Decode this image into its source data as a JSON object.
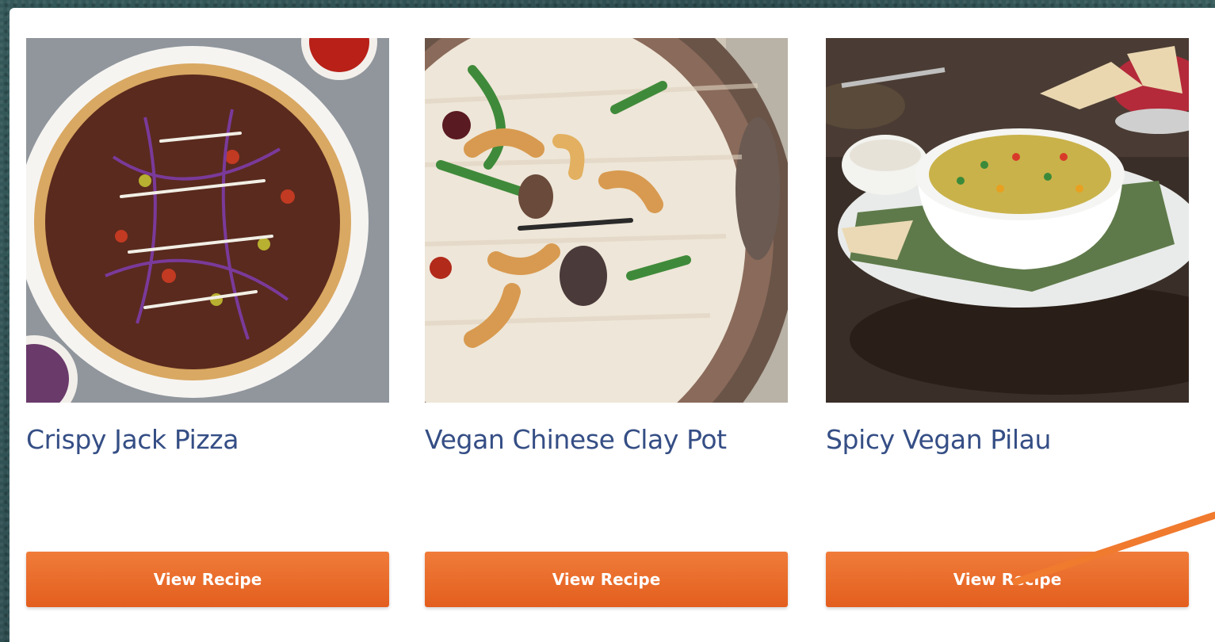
{
  "cards": [
    {
      "title": "Crispy Jack Pizza",
      "button_label": "View Recipe",
      "image_icon": "pizza-photo-icon"
    },
    {
      "title": "Vegan Chinese Clay Pot",
      "button_label": "View Recipe",
      "image_icon": "clay-pot-rice-photo-icon"
    },
    {
      "title": "Spicy Vegan Pilau",
      "button_label": "View Recipe",
      "image_icon": "pilau-rice-bowl-photo-icon"
    }
  ],
  "colors": {
    "accent_button": "#ec6a2a",
    "title_text": "#354e85",
    "annotation_arrow": "#f07a2e",
    "background": "#35595a"
  }
}
